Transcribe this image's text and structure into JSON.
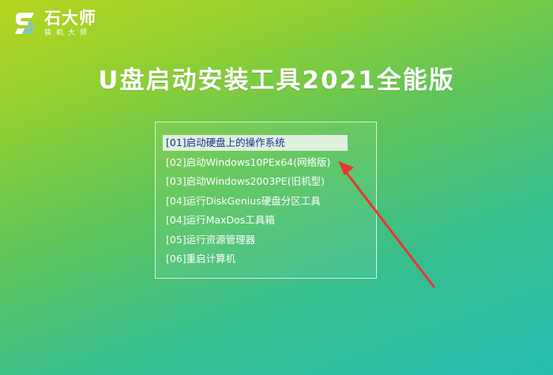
{
  "logo": {
    "title": "石大师",
    "subtitle": "装机大师"
  },
  "main_title": "U盘启动安装工具2021全能版",
  "menu": {
    "items": [
      {
        "label": "[01]启动硬盘上的操作系统",
        "selected": true
      },
      {
        "label": "[02]启动Windows10PEx64(网络版)",
        "selected": false
      },
      {
        "label": "[03]启动Windows2003PE(旧机型)",
        "selected": false
      },
      {
        "label": "[04]运行DiskGenius硬盘分区工具",
        "selected": false
      },
      {
        "label": "[04]运行MaxDos工具箱",
        "selected": false
      },
      {
        "label": "[05]运行资源管理器",
        "selected": false
      },
      {
        "label": "[06]重启计算机",
        "selected": false
      }
    ]
  },
  "colors": {
    "selected_bg": "#dff0dd",
    "selected_text": "#1a2f9a",
    "menu_text": "#ffffff",
    "arrow": "#e8352f",
    "background_top": "#b4d51e",
    "background_bottom": "#25bcb0"
  },
  "icons": {
    "logo": "shidashi-logo-icon",
    "annotation": "red-arrow-icon"
  }
}
